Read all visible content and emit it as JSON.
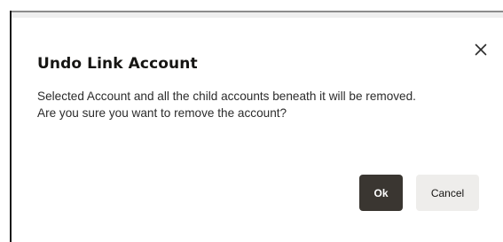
{
  "dialog": {
    "title": "Undo Link Account",
    "message_line1": "Selected Account and all the child accounts beneath it will be removed.",
    "message_line2": "Are you sure you want to remove the account?",
    "close_icon": "close-icon",
    "ok_label": "Ok",
    "cancel_label": "Cancel"
  },
  "colors": {
    "ok_button_bg": "#3a3631",
    "cancel_button_bg": "#eeedeb",
    "text": "#161513"
  }
}
